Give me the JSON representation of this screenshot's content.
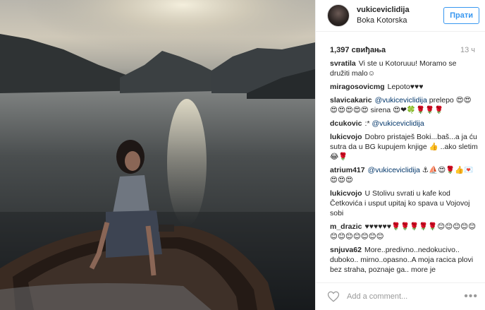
{
  "header": {
    "username": "vukiceviclidija",
    "location": "Boka Kotorska",
    "follow_label": "Прати"
  },
  "stats": {
    "likes": "1,397 свиђања",
    "time": "13 ч"
  },
  "comments": [
    {
      "user": "svratila",
      "parts": [
        {
          "t": "Vi ste u Kotoruuu! Moramo se družiti malo☺"
        }
      ]
    },
    {
      "user": "miragosovicmg",
      "parts": [
        {
          "t": "Lepoto♥♥♥"
        }
      ]
    },
    {
      "user": "slavicakaric",
      "parts": [
        {
          "t": "@vukiceviclidija",
          "m": true
        },
        {
          "t": " prelepo 😍😍😍😍😍😍😍 sirena 😍❤🍀🌹🌹🌹"
        }
      ]
    },
    {
      "user": "dcukovic",
      "parts": [
        {
          "t": ":* "
        },
        {
          "t": "@vukiceviclidija",
          "m": true
        }
      ]
    },
    {
      "user": "lukicvojo",
      "parts": [
        {
          "t": "Dobro pristaješ Boki...baš...a ja ću sutra da u BG kupujem knjige 👍 ..ako sletim 😂🌹"
        }
      ]
    },
    {
      "user": "atrium417",
      "parts": [
        {
          "t": "@vukiceviclidija",
          "m": true
        },
        {
          "t": " ⚓⛵😍🌹👍💌😍😍😍"
        }
      ]
    },
    {
      "user": "lukicvojo",
      "parts": [
        {
          "t": "U Stolivu svrati u kafe kod Četkovića i usput upitaj ko spava u Vojovoj sobi"
        }
      ]
    },
    {
      "user": "m_drazic",
      "parts": [
        {
          "t": "♥♥♥♥♥♥🌹🌹🌹🌹🌹😊😊😊😊😊😊😊😊😊😊😊😊"
        }
      ]
    },
    {
      "user": "snjuva62",
      "parts": [
        {
          "t": "More..predivno..nedokucivo.. duboko.. mirno..opasno..A moja racica plovi bez straha, poznaje ga.. more je"
        }
      ]
    }
  ],
  "footer": {
    "placeholder": "Add a comment...",
    "more": "•••"
  }
}
